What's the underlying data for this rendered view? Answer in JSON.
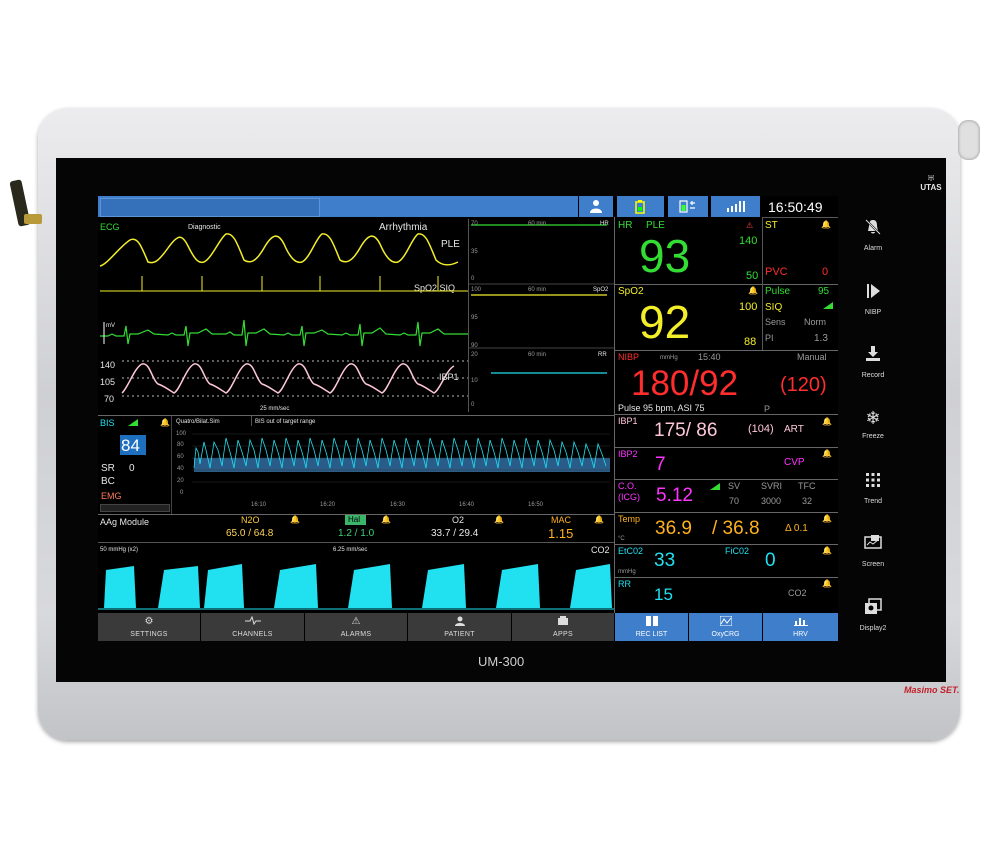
{
  "device": {
    "model": "UM-300",
    "brand": "UTAS",
    "sensor_logo": "Masimo SET."
  },
  "header": {
    "time": "16:50:49",
    "status_icons": [
      "patient-icon",
      "battery-icon",
      "power-battery-icon",
      "signal-icon"
    ]
  },
  "waves": {
    "ecg": {
      "label": "ECG",
      "diagnostic": "Diagnostic",
      "arrhythmia": "Arrhythmia",
      "ple": "PLE",
      "spo2_siq": "SpO2 SIQ",
      "mv": "mV"
    },
    "ibp": {
      "scale_top": "140",
      "scale_mid": "105",
      "scale_bottom": "70",
      "label": "IBP1",
      "speed": "25 mm/sec"
    }
  },
  "trends": {
    "hr": {
      "top": "70",
      "mid": "35",
      "bottom": "0",
      "span": "60 min",
      "label": "HR"
    },
    "spo2": {
      "top": "100",
      "mid": "95",
      "bottom": "90",
      "span": "60 min",
      "label": "SpO2"
    },
    "rr": {
      "top": "20",
      "mid": "10",
      "bottom": "0",
      "span": "60 min",
      "label": "RR"
    }
  },
  "bis": {
    "label": "BIS",
    "value": "84",
    "sr_label": "SR",
    "sr_value": "0",
    "bc_label": "BC",
    "emg_label": "EMG",
    "mode": "Quatro/Bilat.Sim",
    "status": "BIS out of target range",
    "yticks": [
      "100",
      "80",
      "60",
      "40",
      "20",
      "0"
    ],
    "xticks": [
      "16:10",
      "16:20",
      "16:30",
      "16:40",
      "16:50"
    ]
  },
  "aag": {
    "module": "AAg Module",
    "n2o_label": "N2O",
    "n2o_value": "65.0 / 64.8",
    "hal_label": "Hal",
    "hal_value": "1.2 / 1.0",
    "o2_label": "O2",
    "o2_value": "33.7 / 29.4",
    "mac_label": "MAC",
    "mac_value": "1.15"
  },
  "co2_wave": {
    "scale": "50 mmHg (x2)",
    "speed": "6.25 mm/sec",
    "label": "CO2"
  },
  "params": {
    "hr": {
      "label": "HR",
      "source": "PLE",
      "value": "93",
      "high": "140",
      "low": "50"
    },
    "st": {
      "label": "ST",
      "pvc_label": "PVC",
      "pvc_value": "0"
    },
    "spo2": {
      "label": "SpO2",
      "value": "92",
      "high": "100",
      "low": "88"
    },
    "pulse": {
      "label": "Pulse",
      "value": "95",
      "siq_label": "SIQ",
      "sens_label": "Sens",
      "sens_value": "Norm",
      "pi_label": "PI",
      "pi_value": "1.3"
    },
    "nibp": {
      "label": "NIBP",
      "unit": "mmHg",
      "time": "15:40",
      "mode": "Manual",
      "value": "180/92",
      "mean": "(120)",
      "info": "Pulse 95 bpm, ASI 75",
      "p_label": "P"
    },
    "ibp1": {
      "label": "IBP1",
      "value": "175/ 86",
      "mean": "(104)",
      "site": "ART"
    },
    "ibp2": {
      "label": "IBP2",
      "value": "7",
      "site": "CVP"
    },
    "co": {
      "label": "C.O.",
      "sub": "(ICG)",
      "value": "5.12",
      "sv_label": "SV",
      "sv_value": "70",
      "svri_label": "SVRI",
      "svri_value": "3000",
      "tfc_label": "TFC",
      "tfc_value": "32"
    },
    "temp": {
      "label": "Temp",
      "unit": "°C",
      "value1": "36.9",
      "value2": "/ 36.8",
      "delta": "Δ 0.1"
    },
    "etco2": {
      "label": "EtC02",
      "unit": "mmHg",
      "value": "33",
      "fi_label": "FiC02",
      "fi_value": "0"
    },
    "rr": {
      "label": "RR",
      "value": "15",
      "source": "CO2"
    }
  },
  "bottom_buttons": [
    {
      "label": "SETTINGS",
      "icon": "gear-icon"
    },
    {
      "label": "CHANNELS",
      "icon": "waveform-icon"
    },
    {
      "label": "ALARMS",
      "icon": "alarm-triangle-icon"
    },
    {
      "label": "PATIENT",
      "icon": "patient-icon"
    },
    {
      "label": "APPS",
      "icon": "apps-icon"
    }
  ],
  "blue_buttons": [
    {
      "label": "REC LIST",
      "icon": "record-list-icon"
    },
    {
      "label": "OxyCRG",
      "icon": "oxycrg-icon"
    },
    {
      "label": "HRV",
      "icon": "hrv-icon"
    }
  ],
  "side_buttons": [
    {
      "label": "Alarm",
      "icon": "alarm-off-icon"
    },
    {
      "label": "NIBP",
      "icon": "nibp-play-icon"
    },
    {
      "label": "Record",
      "icon": "record-icon"
    },
    {
      "label": "Freeze",
      "icon": "freeze-icon"
    },
    {
      "label": "Trend",
      "icon": "trend-grid-icon"
    },
    {
      "label": "Screen",
      "icon": "screen-icon"
    },
    {
      "label": "Display2",
      "icon": "display2-icon"
    }
  ],
  "colors": {
    "background": "#000000",
    "accent_blue": "#3f7ecb",
    "ecg": "#f3ee2a",
    "spo2_wave": "#33dd33",
    "co2_wave": "#21e0f0",
    "alarm": "#ff2d2d"
  }
}
